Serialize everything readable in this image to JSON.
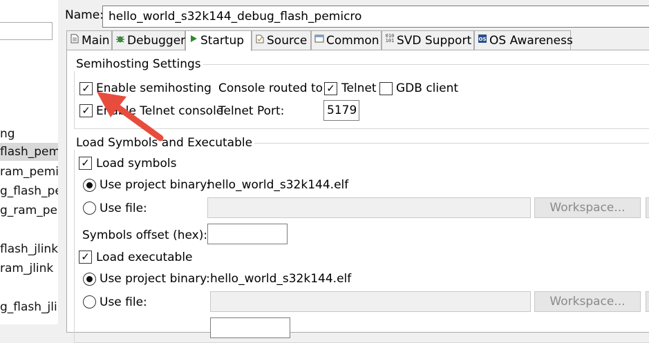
{
  "left_panel": {
    "items": [
      "ng",
      "flash_pemi",
      "ram_pemic",
      "g_flash_per",
      "g_ram_pem",
      "flash_jlink",
      "ram_jlink",
      "g_flash_jlinl"
    ]
  },
  "config": {
    "name_label": "Name:",
    "name_value": "hello_world_s32k144_debug_flash_pemicro"
  },
  "tabs": [
    {
      "label": "Main",
      "icon": "page-icon"
    },
    {
      "label": "Debugger",
      "icon": "bug-icon"
    },
    {
      "label": "Startup",
      "icon": "play-icon",
      "active": true
    },
    {
      "label": "Source",
      "icon": "source-icon"
    },
    {
      "label": "Common",
      "icon": "window-icon"
    },
    {
      "label": "SVD Support",
      "icon": "binary-icon"
    },
    {
      "label": "OS Awareness",
      "icon": "os-icon"
    }
  ],
  "semihosting": {
    "title": "Semihosting Settings",
    "enable_label": "Enable semihosting",
    "enable_checked": true,
    "console_routed_label": "Console routed to:",
    "telnet_label": "Telnet",
    "telnet_checked": true,
    "gdb_client_label": "GDB client",
    "gdb_client_checked": false,
    "enable_telnet_label": "Enable Telnet console",
    "enable_telnet_checked": true,
    "telnet_port_label": "Telnet Port:",
    "telnet_port_value": "5179"
  },
  "load": {
    "title": "Load Symbols and Executable",
    "load_symbols_label": "Load symbols",
    "load_symbols_checked": true,
    "symbols_use_project_label": "Use project binary:",
    "symbols_project_binary": "hello_world_s32k144.elf",
    "symbols_use_file_label": "Use file:",
    "symbols_workspace_label": "Workspace...",
    "symbols_offset_label": "Symbols offset (hex):",
    "symbols_offset_value": "",
    "load_executable_label": "Load executable",
    "load_executable_checked": true,
    "exec_use_project_label": "Use project binary:",
    "exec_project_binary": "hello_world_s32k144.elf",
    "exec_use_file_label": "Use file:",
    "exec_workspace_label": "Workspace..."
  },
  "annotation": {
    "color": "#e84c3d"
  }
}
